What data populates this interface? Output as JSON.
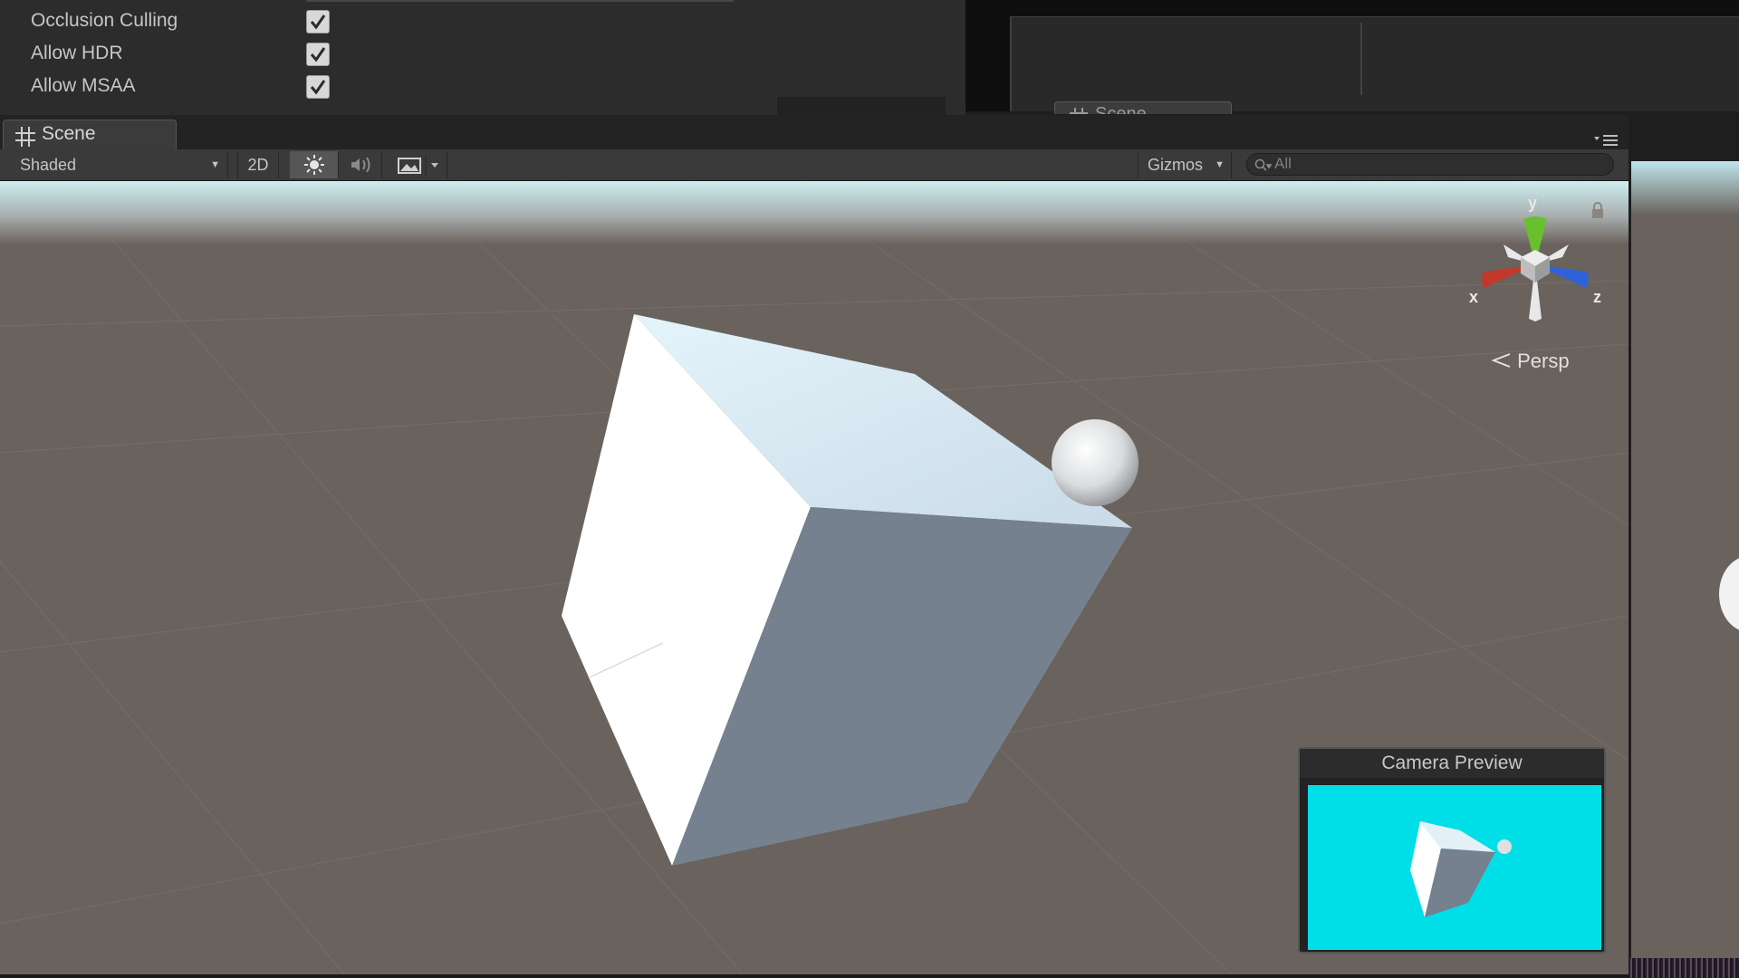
{
  "inspector": {
    "properties": [
      {
        "label": "Occlusion Culling",
        "checked": true
      },
      {
        "label": "Allow HDR",
        "checked": true
      },
      {
        "label": "Allow MSAA",
        "checked": true
      }
    ]
  },
  "background_window": {
    "tab_label": "Scene"
  },
  "scene_window": {
    "tab_label": "Scene",
    "toolbar": {
      "draw_mode": "Shaded",
      "twod_label": "2D",
      "gizmos_label": "Gizmos",
      "search_placeholder": "All"
    },
    "orientation_gizmo": {
      "y_label": "y",
      "x_label": "x",
      "z_label": "z",
      "projection_label": "Persp"
    },
    "camera_preview": {
      "title": "Camera Preview",
      "background_color": "#00dfe8"
    }
  },
  "colors": {
    "editor_bg": "#2c2c2c",
    "ground": "#6a625d",
    "sky": "#bfe6ec",
    "axis_x": "#c0392b",
    "axis_y": "#6abf2e",
    "axis_z": "#2f62d8"
  }
}
